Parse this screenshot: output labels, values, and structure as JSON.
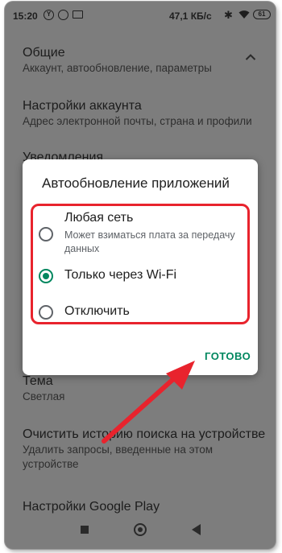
{
  "status_bar": {
    "time": "15:20",
    "network_speed": "47,1 КБ/с",
    "battery_level": "61",
    "icons": [
      "yandex-icon",
      "location-icon",
      "screen-icon",
      "bluetooth-icon",
      "wifi-icon",
      "battery-icon"
    ]
  },
  "settings": {
    "general": {
      "title": "Общие",
      "subtitle": "Аккаунт, автообновление, параметры"
    },
    "account": {
      "title": "Настройки аккаунта",
      "subtitle": "Адрес электронной почты, страна и профили"
    },
    "notifications": {
      "title": "Уведомления"
    },
    "theme": {
      "title": "Тема",
      "subtitle": "Светлая"
    },
    "clear_history": {
      "title": "Очистить историю поиска на устройстве",
      "subtitle_line1": "Удалить запросы, введенные на этом",
      "subtitle_line2": "устройстве"
    },
    "google_play": {
      "title": "Настройки Google Play"
    }
  },
  "dialog": {
    "title": "Автообновление приложений",
    "options": [
      {
        "label": "Любая сеть",
        "sub_line1": "Может взиматься плата за передачу",
        "sub_line2": "данных",
        "selected": false
      },
      {
        "label": "Только через Wi-Fi",
        "selected": true
      },
      {
        "label": "Отключить",
        "selected": false
      }
    ],
    "done_label": "ГОТОВО"
  },
  "colors": {
    "accent": "#01875f",
    "annotation_red": "#e8232d",
    "scrim": "#7d7d7d"
  }
}
